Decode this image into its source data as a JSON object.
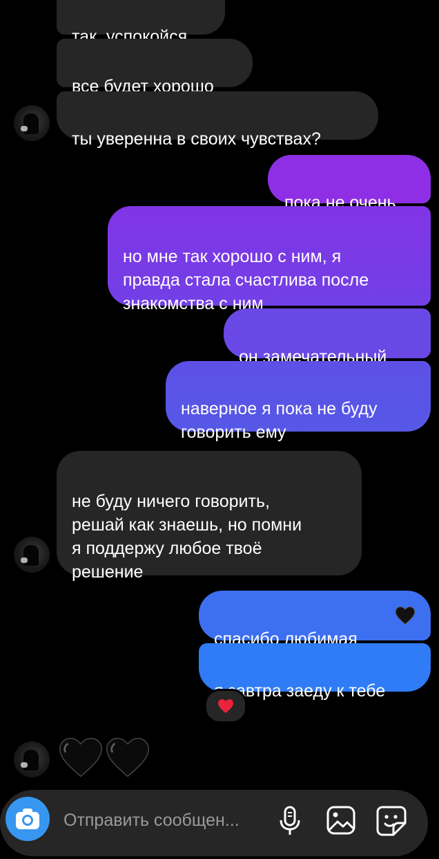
{
  "messages": [
    {
      "from": "them",
      "text": "так, успокойся"
    },
    {
      "from": "them",
      "text": "все будет хорошо"
    },
    {
      "from": "them",
      "text": "ты уверенна в своих чувствах?"
    },
    {
      "from": "me",
      "text": "пока не очень"
    },
    {
      "from": "me",
      "text": "но мне так хорошо с ним, я\nправда стала счастлива после\nзнакомства с ним"
    },
    {
      "from": "me",
      "text": "он замечательный"
    },
    {
      "from": "me",
      "text": "наверное я пока не буду\nговорить ему"
    },
    {
      "from": "them",
      "text": "не буду ничего говорить,\nрешай как знаешь, но помни\nя поддержу любое твоё\nрешение"
    },
    {
      "from": "me",
      "text": "спасибо любимая"
    },
    {
      "from": "me",
      "text": "я завтра заеду к тебе"
    }
  ],
  "reaction": {
    "icon": "red-heart-icon",
    "color": "#e8253a"
  },
  "hearts_message": {
    "count": 2,
    "icon": "black-heart-icon"
  },
  "composer": {
    "placeholder": "Отправить сообщен...",
    "icons": [
      "camera-icon",
      "microphone-icon",
      "gallery-icon",
      "sticker-icon"
    ]
  },
  "colors": {
    "incoming": "#262626",
    "outgoing_top": "#8e2fe6",
    "outgoing_mid": "#5a52e6",
    "outgoing_bottom": "#2f7cf6",
    "accent": "#3797f0"
  }
}
